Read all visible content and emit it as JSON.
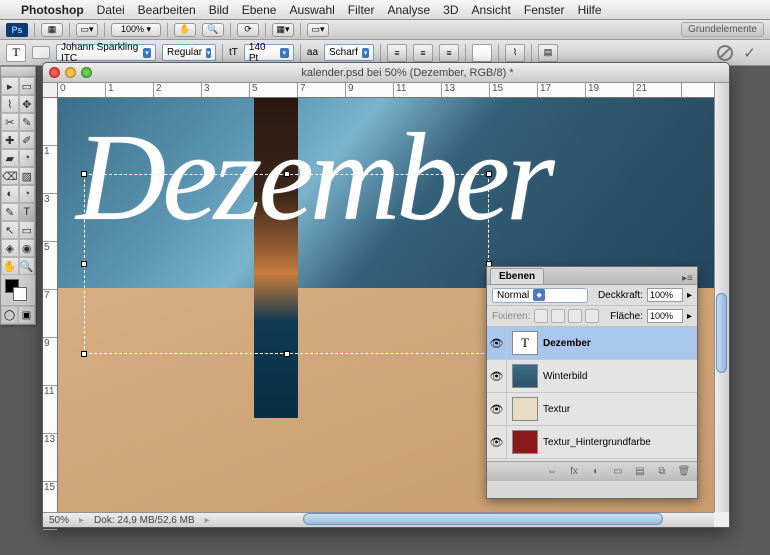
{
  "menu": {
    "apple": "",
    "appname": "Photoshop",
    "items": [
      "Datei",
      "Bearbeiten",
      "Bild",
      "Ebene",
      "Auswahl",
      "Filter",
      "Analyse",
      "3D",
      "Ansicht",
      "Fenster",
      "Hilfe"
    ]
  },
  "appbar": {
    "zoom": "100% ▾",
    "workspace": "Grundelemente"
  },
  "options": {
    "font_family": "Johann Sparkling ITC",
    "font_style": "Regular",
    "size_icon": "tT",
    "font_size": "140 Pt",
    "aa_label": "aa",
    "aa_mode": "Scharf"
  },
  "document": {
    "title": "kalender.psd bei 50% (Dezember, RGB/8) *",
    "zoom": "50%",
    "doc_size": "Dok: 24,9 MB/52,6 MB",
    "canvas_text": "Dezember"
  },
  "ruler_h": [
    "0",
    "1",
    "2",
    "3",
    "5",
    "7",
    "9",
    "11",
    "13",
    "15",
    "17",
    "19",
    "21"
  ],
  "ruler_v": [
    "",
    "1",
    "3",
    "5",
    "7",
    "9",
    "11",
    "13",
    "15"
  ],
  "layers_panel": {
    "tab": "Ebenen",
    "blend": "Normal",
    "opacity_label": "Deckkraft:",
    "opacity": "100%",
    "lock_label": "Fixieren:",
    "fill_label": "Fläche:",
    "fill": "100%",
    "layers": [
      {
        "name": "Dezember",
        "kind": "text",
        "selected": true,
        "thumb": "T"
      },
      {
        "name": "Winterbild",
        "kind": "raster",
        "thumb_bg": "linear-gradient(#3b6f89,#2c5269)"
      },
      {
        "name": "Textur",
        "kind": "raster",
        "thumb_bg": "#e8dcc4"
      },
      {
        "name": "Textur_Hintergrundfarbe",
        "kind": "raster",
        "thumb_bg": "#8b1a1a"
      }
    ],
    "footer_icons": [
      "⇔",
      "fx",
      "◐",
      "▭",
      "▤",
      "⧉",
      "🗑"
    ]
  },
  "tools": [
    "▭",
    "▶",
    "◫",
    "✥",
    "✎",
    "✂",
    "✐",
    "✚",
    "▰",
    "◔",
    "⌫",
    "◆",
    "▨",
    "◐",
    "✎",
    "T",
    "↖",
    "▭",
    "✋",
    "🔍"
  ]
}
